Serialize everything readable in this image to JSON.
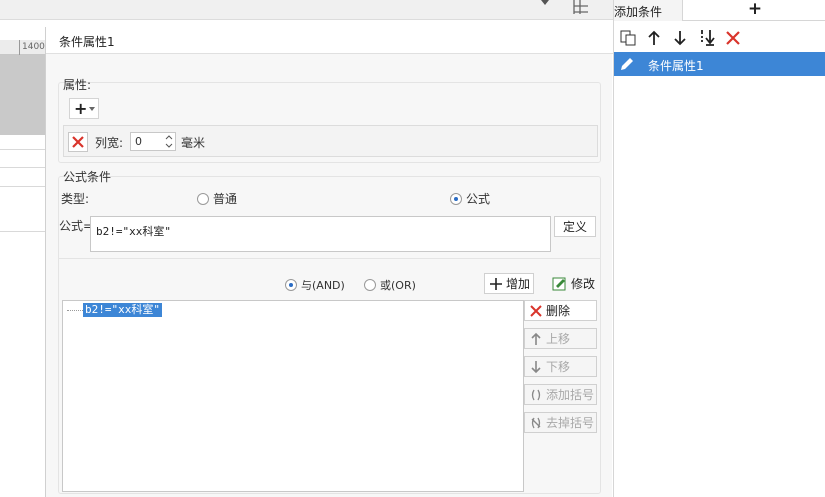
{
  "canvas": {
    "ruler_number": "1400"
  },
  "dialog": {
    "title": "条件属性1",
    "attributes": {
      "group_label": "属性:",
      "add_button_icon": "plus-icon",
      "row_label": "列宽:",
      "value": "0",
      "unit": "毫米"
    },
    "formula_condition": {
      "group_label": "公式条件",
      "type_label": "类型:",
      "type_options": [
        {
          "label": "普通",
          "selected": false
        },
        {
          "label": "公式",
          "selected": true
        }
      ],
      "formula_label": "公式=",
      "formula_value": "b2!=\"xx科室\"",
      "define_button": "定义",
      "logic_options": [
        {
          "label": "与(AND)",
          "selected": true
        },
        {
          "label": "或(OR)",
          "selected": false
        }
      ],
      "add_button": "增加",
      "modify_button": "修改",
      "conditions": [
        "b2!=\"xx科室\""
      ],
      "delete_button": "删除",
      "up_button": "上移",
      "down_button": "下移",
      "add_bracket_button": "添加括号",
      "remove_bracket_button": "去掉括号"
    }
  },
  "right_panel": {
    "tab_label": "添加条件",
    "add_tab_label": "+",
    "items": [
      "条件属性1"
    ],
    "colors": {
      "selection": "#3d86d6",
      "delete_red": "#d9342b"
    }
  }
}
